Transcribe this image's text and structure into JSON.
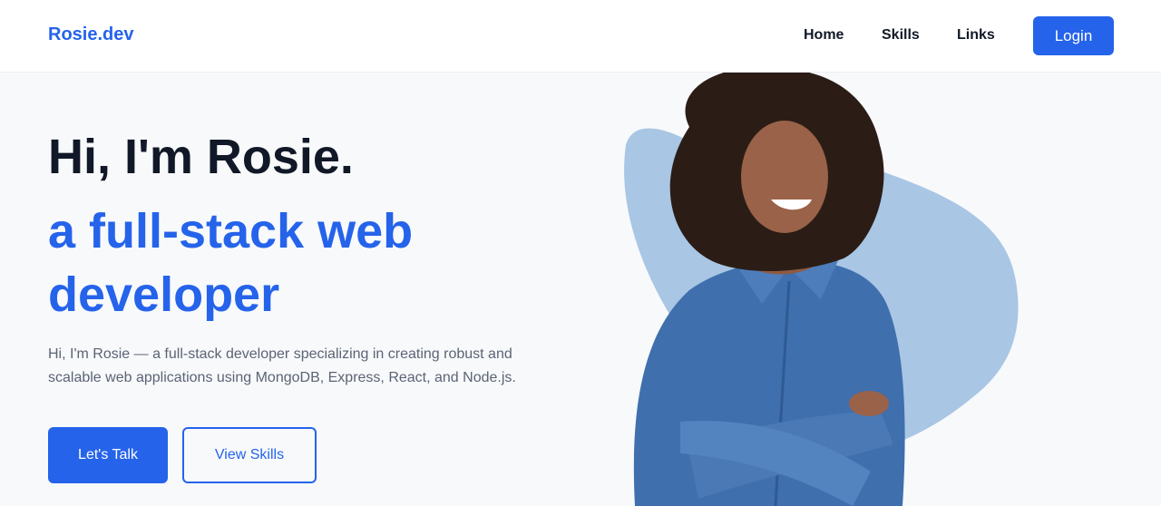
{
  "nav": {
    "brand": "Rosie.dev",
    "links": [
      "Home",
      "Skills",
      "Links"
    ],
    "login_label": "Login"
  },
  "hero": {
    "title": "Hi, I'm Rosie.",
    "subtitle": "a full-stack web developer",
    "description": "Hi, I'm Rosie — a full-stack developer specializing in creating robust and scalable web applications using MongoDB, Express, React, and Node.js.",
    "primary_button": "Let's Talk",
    "secondary_button": "View Skills",
    "image": "portrait-photo"
  },
  "colors": {
    "accent": "#2563eb",
    "heading": "#111827",
    "body_text": "#5b6474",
    "blob": "#a9c6e4",
    "background": "#f8f9fb"
  }
}
